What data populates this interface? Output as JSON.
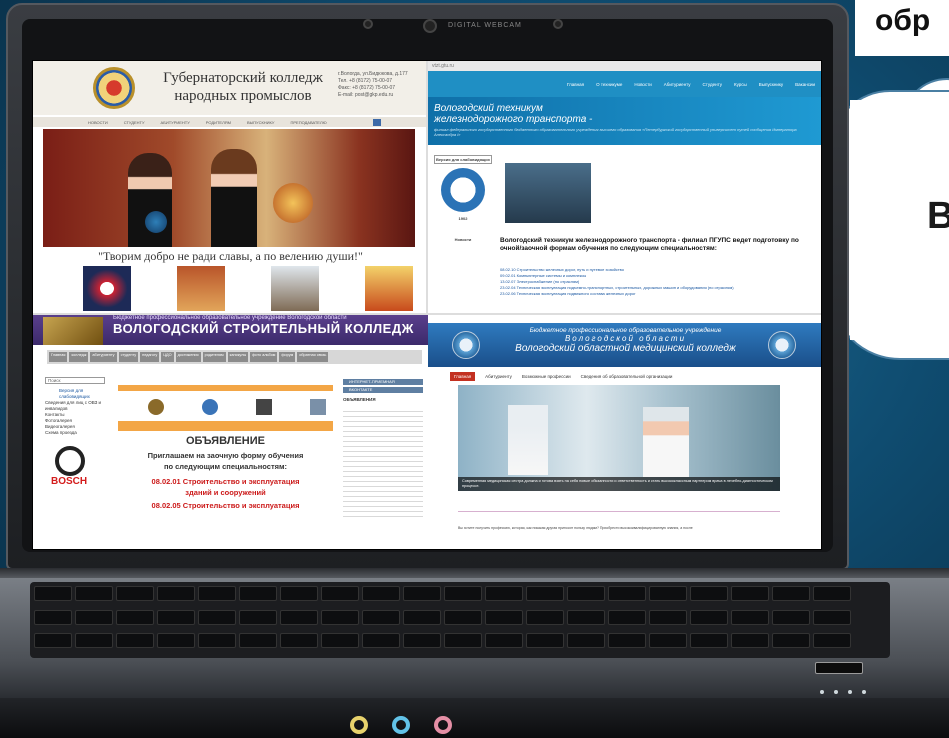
{
  "slide": {
    "title": "обр",
    "cloud_text": "В"
  },
  "laptop": {
    "webcam_label": "DIGITAL WEBCAM"
  },
  "sites": {
    "q1": {
      "title_line1": "Губернаторский колледж",
      "title_line2": "народных промыслов",
      "contacts": [
        "г.Вологда, ул.Бидюкова, д.177",
        "Тел. +8 (8172) 75-00-07",
        "Факс: +8 (8172) 75-00-07",
        "E-mail: post@gkp.edu.ru"
      ],
      "nav": [
        "новости",
        "студенту",
        "абитуриенту",
        "родителям",
        "выпускнику",
        "преподавателю"
      ],
      "slogan": "\"Творим добро не ради славы, а по велению души!\""
    },
    "q2": {
      "url": "vtzt.gtu.ru",
      "nav": [
        "Главная",
        "О техникуме",
        "Новости",
        "Абитуриенту",
        "Студенту",
        "Курсы",
        "Выпускнику",
        "Вакансии"
      ],
      "banner_title1": "Вологодский техникум",
      "banner_title2": "железнодорожного транспорта -",
      "banner_sub": "филиал федерального государственного бюджетного образовательного учреждения высшего образования «Петербургский государственный университет путей сообщения Императора Александра I»",
      "side_label": "Версия для слабовидящих",
      "year": "1902",
      "news_label": "Новости",
      "heading": "Вологодский техникум железнодорожного транспорта - филиал ПГУПС ведет подготовку по очной/заочной формам обучения по следующим специальностям:",
      "specialties": [
        "08.02.10 Строительство железных дорог, путь и путевое хозяйство",
        "09.02.01 Компьютерные системы и комплексы",
        "13.02.07 Электроснабжение (по отраслям)",
        "23.02.04 Техническая эксплуатация подъемно-транспортных, строительных, дорожных машин и оборудования (по отраслям)",
        "23.02.06 Техническая эксплуатация подвижного состава железных дорог"
      ]
    },
    "q3": {
      "subtitle": "Бюджетное профессиональное образовательное учреждение Вологодской области",
      "title": "ВОЛОГОДСКИЙ СТРОИТЕЛЬНЫЙ КОЛЛЕДЖ",
      "nav": [
        "Главная",
        "колледж",
        "абитуриенту",
        "студенту",
        "педагогу",
        "ЦДО",
        "достижения",
        "родителям",
        "каникулы",
        "фото альбом",
        "форум",
        "обратная связь"
      ],
      "search_placeholder": "Поиск",
      "left_items": [
        "Версия для слабовидящих",
        "Сведения для лиц с ОВЗ и инвалидов",
        "Контакты",
        "Фотогалерея",
        "Видеогалерея",
        "Схема проезда"
      ],
      "brand": "BOSCH",
      "announcement": "ОБЪЯВЛЕНИЕ",
      "invite_line1": "Приглашаем на заочную форму обучения",
      "invite_line2": "по следующим специальностям:",
      "spec1_line1": "08.02.01 Строительство и эксплуатация",
      "spec1_line2": "зданий и сооружений",
      "spec2": "08.02.05 Строительство и эксплуатация",
      "right_btn1": "ИНТЕРНЕТ-ПРИЕМНАЯ",
      "right_btn2": "ВКОНТАКТЕ",
      "right_heading": "ОБЪЯВЛЕНИЯ"
    },
    "q4": {
      "line1": "Бюджетное профессиональное образовательное учреждение",
      "line2": "Вологодской области",
      "line3": "Вологодский областной медицинский колледж",
      "nav": [
        "Главная",
        "Абитуриенту",
        "Возможные профессии",
        "Сведения об образовательной организации"
      ],
      "caption": "Современная медицинская сестра должна и готова взять на себя новые обязанности и ответственность и стать высококлассным партнером врача в лечебно-диагностическом процессе.",
      "footer": "Вы хотите получить профессию, которая, как никакая другая приносит пользу людям? Приобрести высококвалифицированную знания, а после"
    }
  }
}
